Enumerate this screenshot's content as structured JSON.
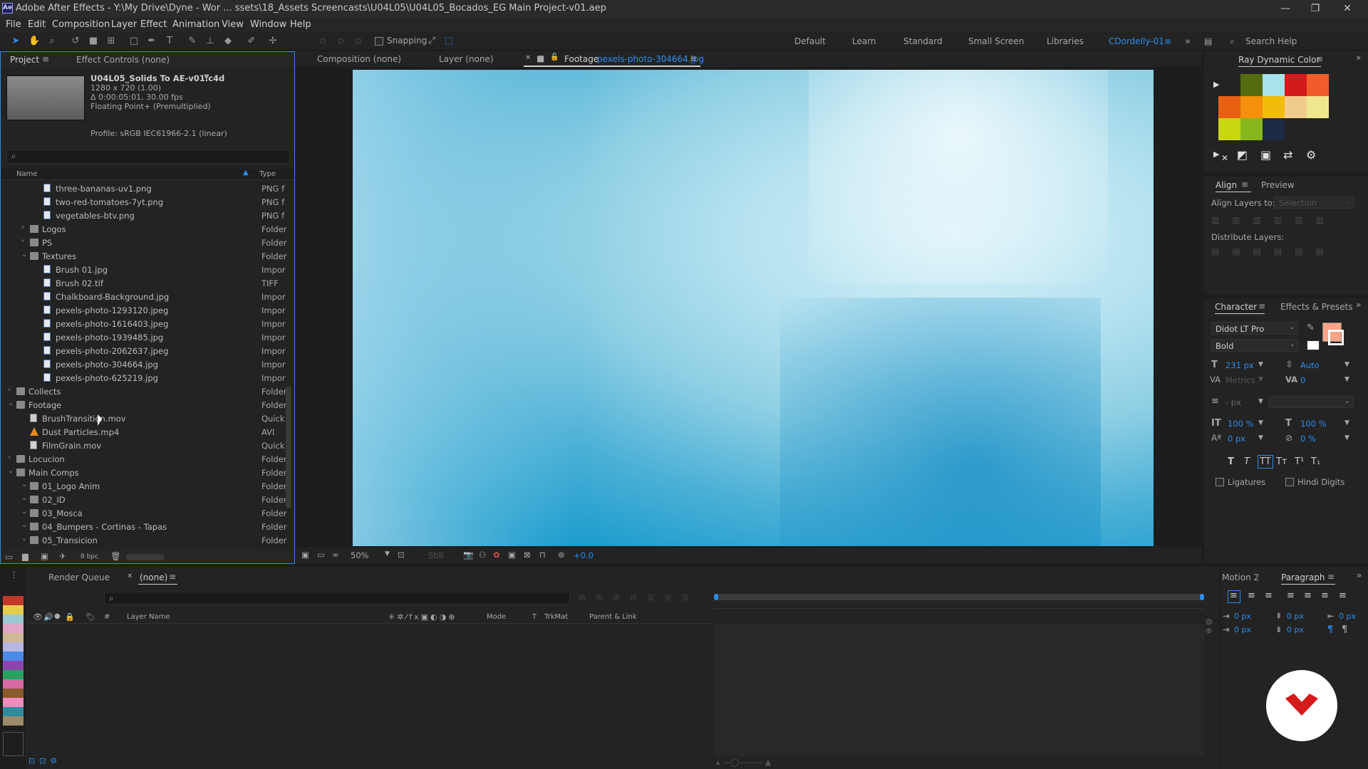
{
  "window": {
    "title": "Adobe After Effects - Y:\\My Drive\\Dyne - Wor ... ssets\\18_Assets Screencasts\\U04L05\\U04L05_Bocados_EG Main Project-v01.aep",
    "logo": "Ae"
  },
  "menu": [
    "File",
    "Edit",
    "Composition",
    "Layer",
    "Effect",
    "Animation",
    "View",
    "Window",
    "Help"
  ],
  "toolbar": {
    "snapping_label": "Snapping",
    "workspaces": [
      "Default",
      "Learn",
      "Standard",
      "Small Screen",
      "Libraries"
    ],
    "active_workspace": "CDordelly-01",
    "search_placeholder": "Search Help"
  },
  "project_panel": {
    "tab_project": "Project",
    "tab_effect_controls": "Effect Controls (none)",
    "selected_item": {
      "name": "U04L05_Solids To AE-v01.c4d",
      "dimensions": "1280 x 720 (1.00)",
      "duration": "Δ 0:00:05:01, 30.00 fps",
      "depth": "Floating Point+ (Premultiplied)",
      "profile": "Profile: sRGB IEC61966-2.1 (linear)"
    },
    "col_name": "Name",
    "col_type": "Type",
    "rows": [
      {
        "name": "three-bananas-uv1.png",
        "type": "PNG f",
        "icon": "image-file-icon",
        "kind": "img",
        "indent": 2
      },
      {
        "name": "two-red-tomatoes-7yt.png",
        "type": "PNG f",
        "icon": "image-file-icon",
        "kind": "img",
        "indent": 2
      },
      {
        "name": "vegetables-btv.png",
        "type": "PNG f",
        "icon": "image-file-icon",
        "kind": "img",
        "indent": 2
      },
      {
        "name": "Logos",
        "type": "Folder",
        "icon": "folder-icon",
        "kind": "folder",
        "indent": 1,
        "expanded": false
      },
      {
        "name": "PS",
        "type": "Folder",
        "icon": "folder-icon",
        "kind": "folder",
        "indent": 1,
        "expanded": false
      },
      {
        "name": "Textures",
        "type": "Folder",
        "icon": "folder-icon",
        "kind": "folder",
        "indent": 1,
        "expanded": true
      },
      {
        "name": "Brush 01.jpg",
        "type": "Impor",
        "icon": "image-file-icon",
        "kind": "img",
        "indent": 2
      },
      {
        "name": "Brush 02.tif",
        "type": "TIFF",
        "icon": "image-file-icon",
        "kind": "img",
        "indent": 2
      },
      {
        "name": "Chalkboard-Background.jpg",
        "type": "Impor",
        "icon": "image-file-icon",
        "kind": "img",
        "indent": 2
      },
      {
        "name": "pexels-photo-1293120.jpeg",
        "type": "Impor",
        "icon": "image-file-icon",
        "kind": "img",
        "indent": 2
      },
      {
        "name": "pexels-photo-1616403.jpeg",
        "type": "Impor",
        "icon": "image-file-icon",
        "kind": "img",
        "indent": 2
      },
      {
        "name": "pexels-photo-1939485.jpg",
        "type": "Impor",
        "icon": "image-file-icon",
        "kind": "img",
        "indent": 2
      },
      {
        "name": "pexels-photo-2062637.jpeg",
        "type": "Impor",
        "icon": "image-file-icon",
        "kind": "img",
        "indent": 2
      },
      {
        "name": "pexels-photo-304664.jpg",
        "type": "Impor",
        "icon": "image-file-icon",
        "kind": "img",
        "indent": 2
      },
      {
        "name": "pexels-photo-625219.jpg",
        "type": "Impor",
        "icon": "image-file-icon",
        "kind": "img",
        "indent": 2
      },
      {
        "name": "Collects",
        "type": "Folder",
        "icon": "folder-icon",
        "kind": "folder",
        "indent": 0,
        "expanded": false
      },
      {
        "name": "Footage",
        "type": "Folder",
        "icon": "folder-icon",
        "kind": "folder",
        "indent": 0,
        "expanded": true
      },
      {
        "name": "BrushTransition.mov",
        "type": "Quick",
        "icon": "video-file-icon",
        "kind": "vid",
        "indent": 1
      },
      {
        "name": "Dust Particles.mp4",
        "type": "AVI",
        "icon": "avi-file-icon",
        "kind": "avi",
        "indent": 1
      },
      {
        "name": "FilmGrain.mov",
        "type": "Quick",
        "icon": "video-file-icon",
        "kind": "vid",
        "indent": 1
      },
      {
        "name": "Locucion",
        "type": "Folder",
        "icon": "folder-icon",
        "kind": "folder",
        "indent": 0,
        "expanded": false
      },
      {
        "name": "Main Comps",
        "type": "Folder",
        "icon": "folder-icon",
        "kind": "folder",
        "indent": 0,
        "expanded": true
      },
      {
        "name": "01_Logo Anim",
        "type": "Folder",
        "icon": "folder-icon",
        "kind": "folder",
        "indent": 1,
        "expanded": true
      },
      {
        "name": "02_ID",
        "type": "Folder",
        "icon": "folder-icon",
        "kind": "folder",
        "indent": 1,
        "expanded": true
      },
      {
        "name": "03_Mosca",
        "type": "Folder",
        "icon": "folder-icon",
        "kind": "folder",
        "indent": 1,
        "expanded": true
      },
      {
        "name": "04_Bumpers - Cortinas - Tapas",
        "type": "Folder",
        "icon": "folder-icon",
        "kind": "folder",
        "indent": 1,
        "expanded": true
      },
      {
        "name": "05_Transicion",
        "type": "Folder",
        "icon": "folder-icon",
        "kind": "folder",
        "indent": 1,
        "expanded": true
      }
    ],
    "bpc": "8 bpc"
  },
  "viewer": {
    "tab_composition": "Composition (none)",
    "tab_layer": "Layer (none)",
    "tab_footage_prefix": "Footage",
    "tab_footage_name": "pexels-photo-304664.jpg",
    "zoom": "50%",
    "still": "Still",
    "exposure": "+0.0"
  },
  "color_panel": {
    "title": "Ray Dynamic Color",
    "swatches": [
      "#556b10",
      "#a8e2ea",
      "#d41a1a",
      "#f25c2a",
      "#ea6012",
      "#f4900c",
      "#f2bc0c",
      "#f0cc8c",
      "#f0e68e",
      "#c8d612",
      "#86b81c",
      "#1c2a44"
    ]
  },
  "align_panel": {
    "tab_align": "Align",
    "tab_preview": "Preview",
    "align_to_label": "Align Layers to:",
    "align_to_value": "Selection",
    "distribute_label": "Distribute Layers:"
  },
  "character_panel": {
    "tab_character": "Character",
    "tab_effects": "Effects & Presets",
    "font": "Didot LT Pro",
    "style": "Bold",
    "size": "231 px",
    "leading": "Auto",
    "kerning": "Metrics",
    "tracking": "0",
    "stroke": "- px",
    "vscale": "100 %",
    "hscale": "100 %",
    "baseline": "0 px",
    "tsume": "0 %",
    "ligatures": "Ligatures",
    "hindi": "Hindi Digits",
    "fill_color": "#f7a488"
  },
  "timeline": {
    "tab_render_queue": "Render Queue",
    "tab_none": "(none)",
    "col_num": "#",
    "col_layer_name": "Layer Name",
    "col_mode": "Mode",
    "col_t": "T",
    "col_trkmat": "TrkMat",
    "col_parent": "Parent & Link"
  },
  "paragraph_panel": {
    "tab_motion": "Motion 2",
    "tab_paragraph": "Paragraph",
    "values": [
      "0 px",
      "0 px",
      "0 px",
      "0 px",
      "0 px"
    ]
  },
  "label_colors": [
    "#1e1e1e",
    "#c0392b",
    "#e6cc4c",
    "#9bc8d2",
    "#e0a6c6",
    "#cfb896",
    "#b6b6e0",
    "#4c8ae6",
    "#8e44ad",
    "#28a060",
    "#d46aa2",
    "#8b5a2b",
    "#f08cbe",
    "#2c8c9c",
    "#9c8a6a"
  ]
}
